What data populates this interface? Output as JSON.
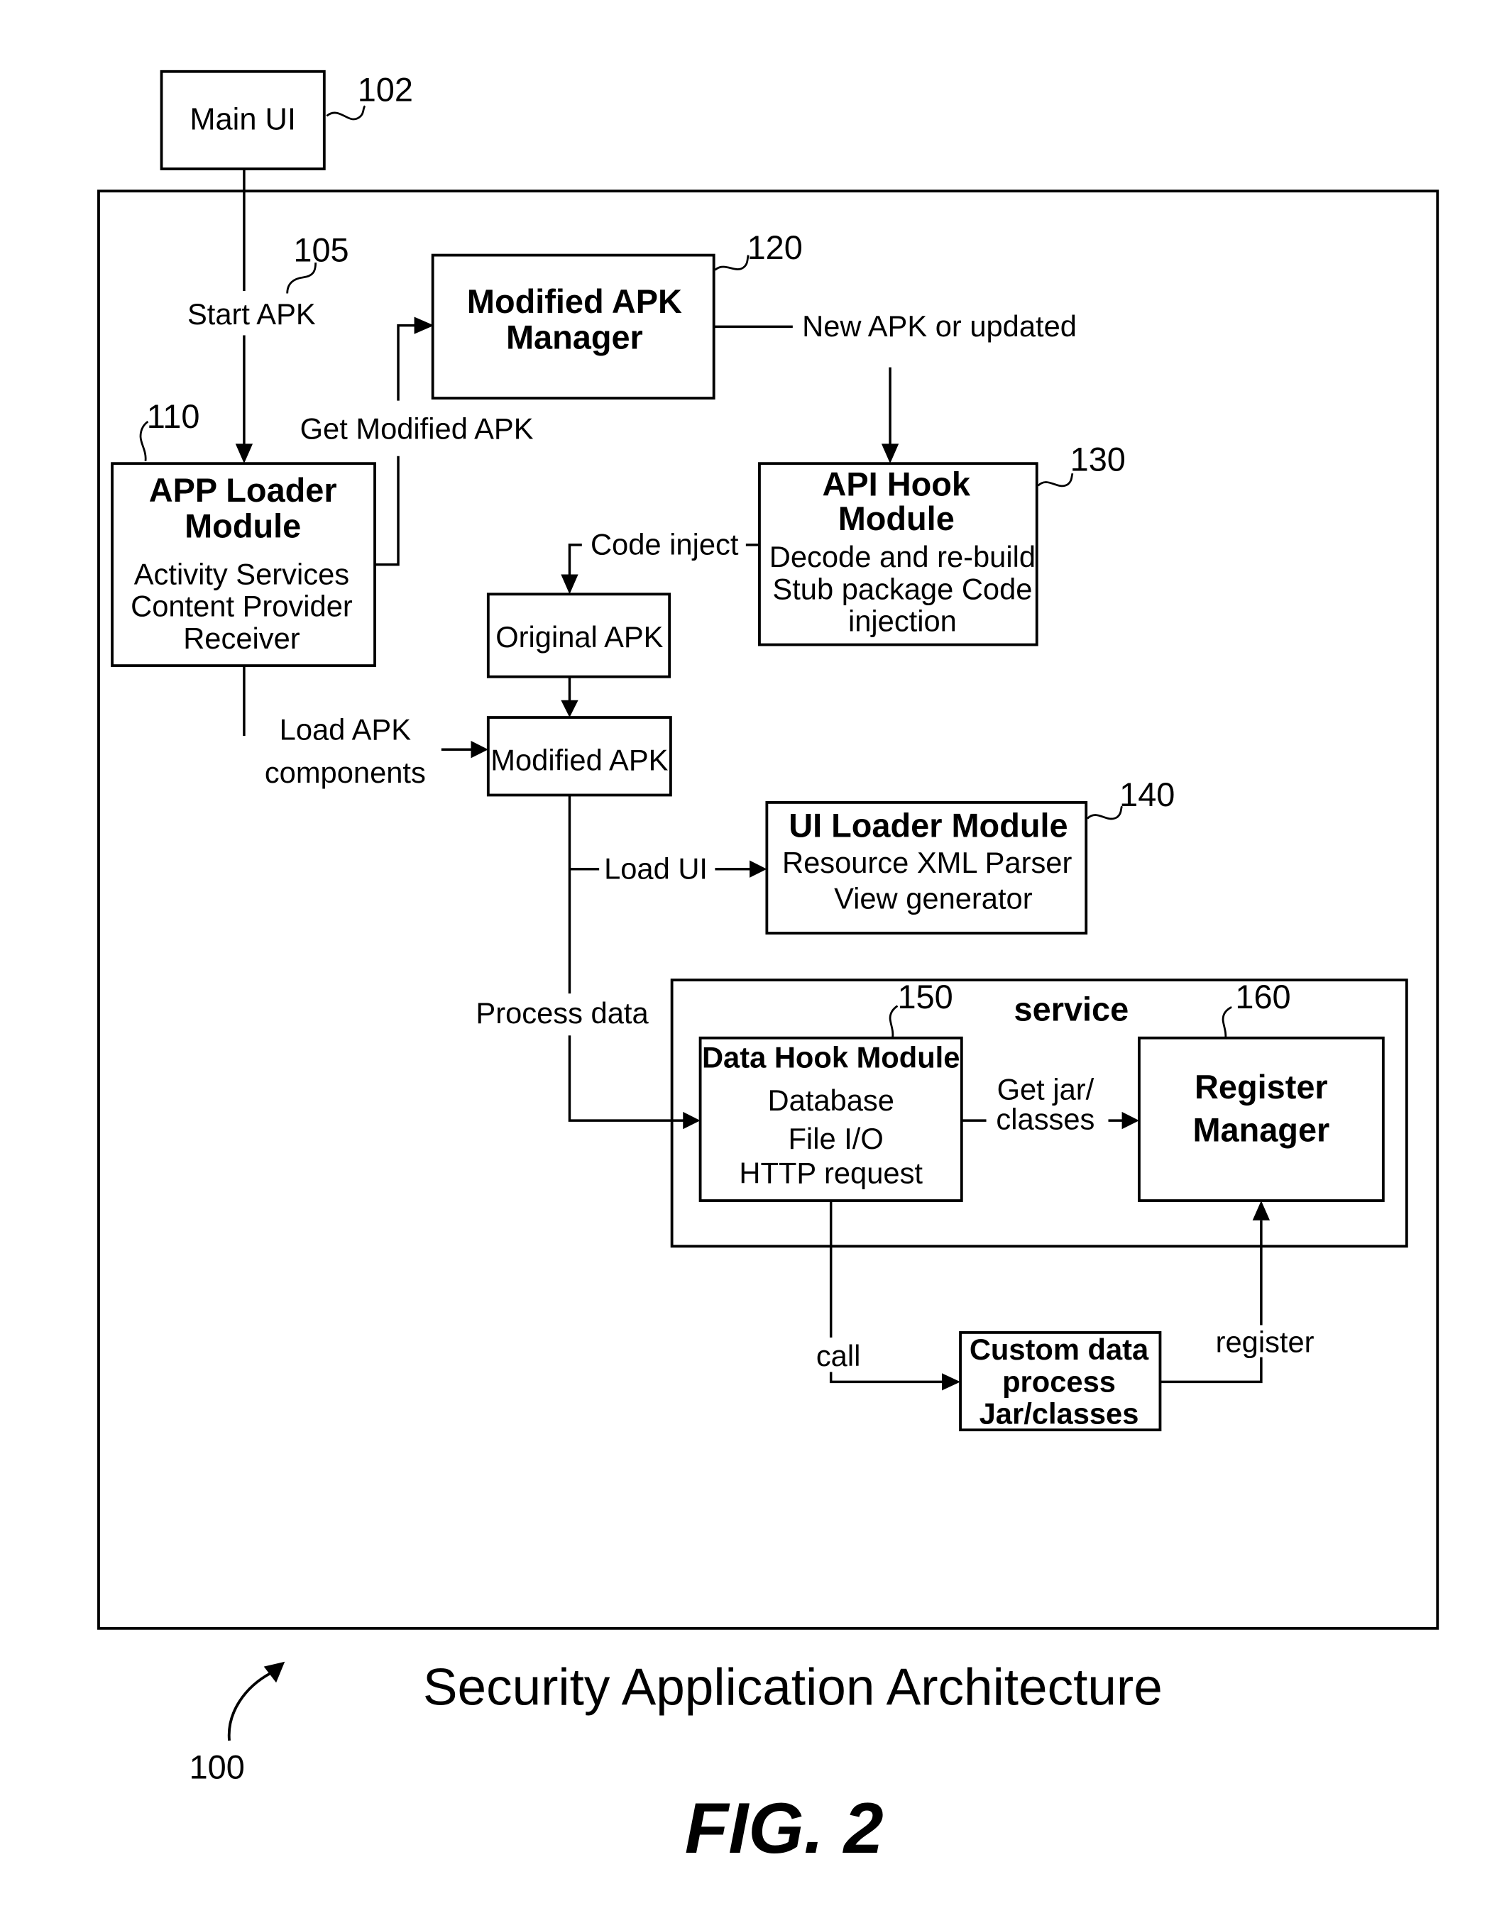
{
  "figure": {
    "title": "Security Application Architecture",
    "fig_label": "FIG. 2",
    "ref_overall": "100"
  },
  "nodes": {
    "main_ui": {
      "label": "Main UI",
      "ref": "102"
    },
    "start_apk": {
      "label": "Start APK",
      "ref": "105"
    },
    "modified_apk_manager": {
      "title_line1": "Modified APK",
      "title_line2": "Manager",
      "ref": "120"
    },
    "app_loader": {
      "title_line1": "APP Loader",
      "title_line2": "Module",
      "lines": [
        "Activity Services",
        "Content Provider",
        "Receiver"
      ],
      "ref": "110"
    },
    "api_hook": {
      "title_line1": "API Hook",
      "title_line2": "Module",
      "lines": [
        "Decode and re-build",
        "Stub package Code",
        "injection"
      ],
      "ref": "130"
    },
    "original_apk": {
      "label": "Original APK"
    },
    "modified_apk": {
      "label": "Modified APK"
    },
    "ui_loader": {
      "title": "UI Loader Module",
      "lines": [
        "Resource XML Parser",
        "View generator"
      ],
      "ref": "140"
    },
    "service": {
      "label": "service"
    },
    "data_hook": {
      "title": "Data Hook Module",
      "lines": [
        "Database",
        "File I/O",
        "HTTP request"
      ],
      "ref": "150"
    },
    "register_manager": {
      "title_line1": "Register",
      "title_line2": "Manager",
      "ref": "160"
    },
    "custom_data": {
      "lines": [
        "Custom data",
        "process",
        "Jar/classes"
      ]
    }
  },
  "edges": {
    "get_modified_apk": "Get Modified APK",
    "new_apk": "New APK or updated",
    "code_inject": "Code inject",
    "load_apk_line1": "Load APK",
    "load_apk_line2": "components",
    "load_ui": "Load UI",
    "process_data": "Process data",
    "get_jar_line1": "Get jar/",
    "get_jar_line2": "classes",
    "call": "call",
    "register": "register"
  }
}
